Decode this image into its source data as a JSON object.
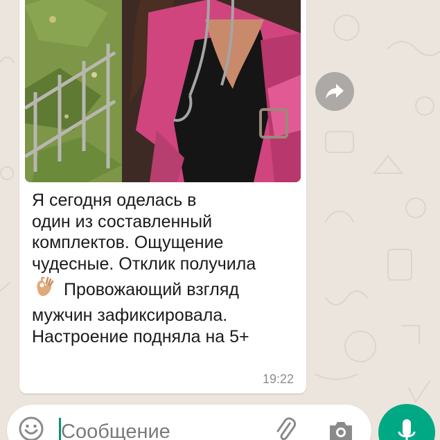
{
  "message": {
    "lines": [
      "Я сегодня оделась в",
      "один из составленный",
      "комплектов. Ощущение",
      "чудесные. Отклик получила",
      "Провожающий взгляд",
      "мужчин зафиксировала.",
      "Настроение подняла на 5+"
    ],
    "emoji_icon": "ok-hand-icon",
    "time": "19:22"
  },
  "composer": {
    "placeholder": "Сообщение",
    "value": ""
  },
  "colors": {
    "accent": "#00a884",
    "bubble": "#ffffff",
    "background": "#ece5dd",
    "time_text": "#8c8c8c"
  },
  "icons": {
    "forward": "share-forward-icon",
    "emoji": "smiley-icon",
    "attach": "paperclip-icon",
    "camera": "camera-icon",
    "mic": "microphone-icon"
  }
}
